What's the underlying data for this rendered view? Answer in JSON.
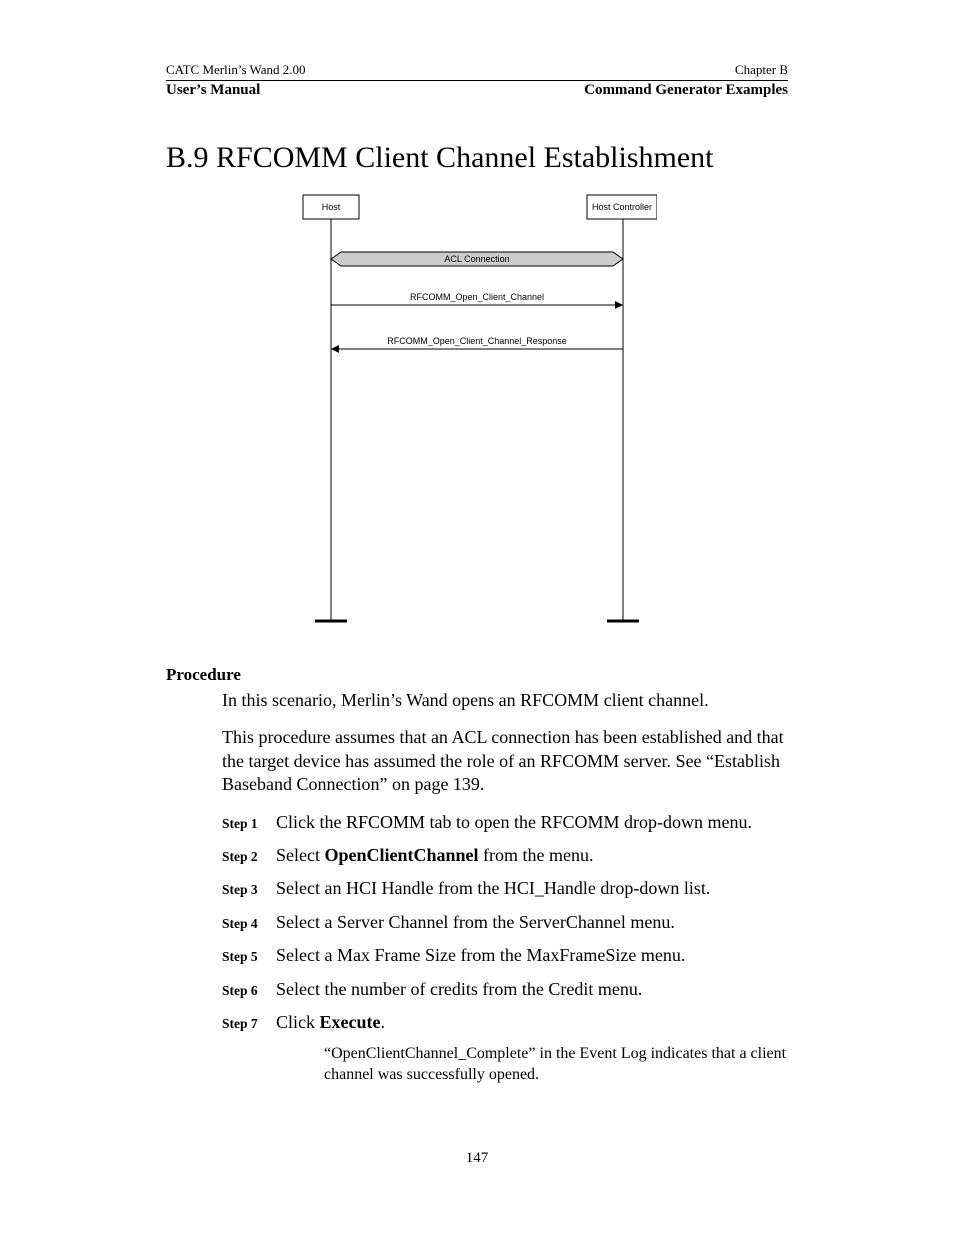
{
  "header": {
    "top_left": "CATC Merlin’s Wand 2.00",
    "top_right": "Chapter B",
    "sub_left": "User’s Manual",
    "sub_right": "Command Generator Examples"
  },
  "title": "B.9  RFCOMM Client Channel Establishment",
  "diagram": {
    "left_box": "Host",
    "right_box": "Host Controller",
    "band": "ACL Connection",
    "arrow1": "RFCOMM_Open_Client_Channel",
    "arrow2": "RFCOMM_Open_Client_Channel_Response"
  },
  "procedure_label": "Procedure",
  "paragraphs": [
    "In this scenario, Merlin’s Wand opens an RFCOMM client channel.",
    "This procedure assumes that an ACL connection has been established and that the target device has assumed the role of an RFCOMM server. See “Establish Baseband Connection” on page 139."
  ],
  "steps": [
    {
      "label": "Step 1",
      "pre": "Click the RFCOMM tab to open the RFCOMM drop-down menu.",
      "bold": "",
      "post": ""
    },
    {
      "label": "Step 2",
      "pre": "Select ",
      "bold": "OpenClientChannel",
      "post": " from the menu."
    },
    {
      "label": "Step 3",
      "pre": "Select an HCI Handle from the HCI_Handle drop-down list.",
      "bold": "",
      "post": ""
    },
    {
      "label": "Step 4",
      "pre": "Select a Server Channel from the ServerChannel menu.",
      "bold": "",
      "post": ""
    },
    {
      "label": "Step 5",
      "pre": "Select a Max Frame Size from the MaxFrameSize menu.",
      "bold": "",
      "post": ""
    },
    {
      "label": "Step 6",
      "pre": "Select the number of credits from the Credit menu.",
      "bold": "",
      "post": ""
    },
    {
      "label": "Step 7",
      "pre": "Click ",
      "bold": "Execute",
      "post": "."
    }
  ],
  "note": "“OpenClientChannel_Complete” in the Event Log indicates that a client channel was successfully opened.",
  "page_number": "147"
}
